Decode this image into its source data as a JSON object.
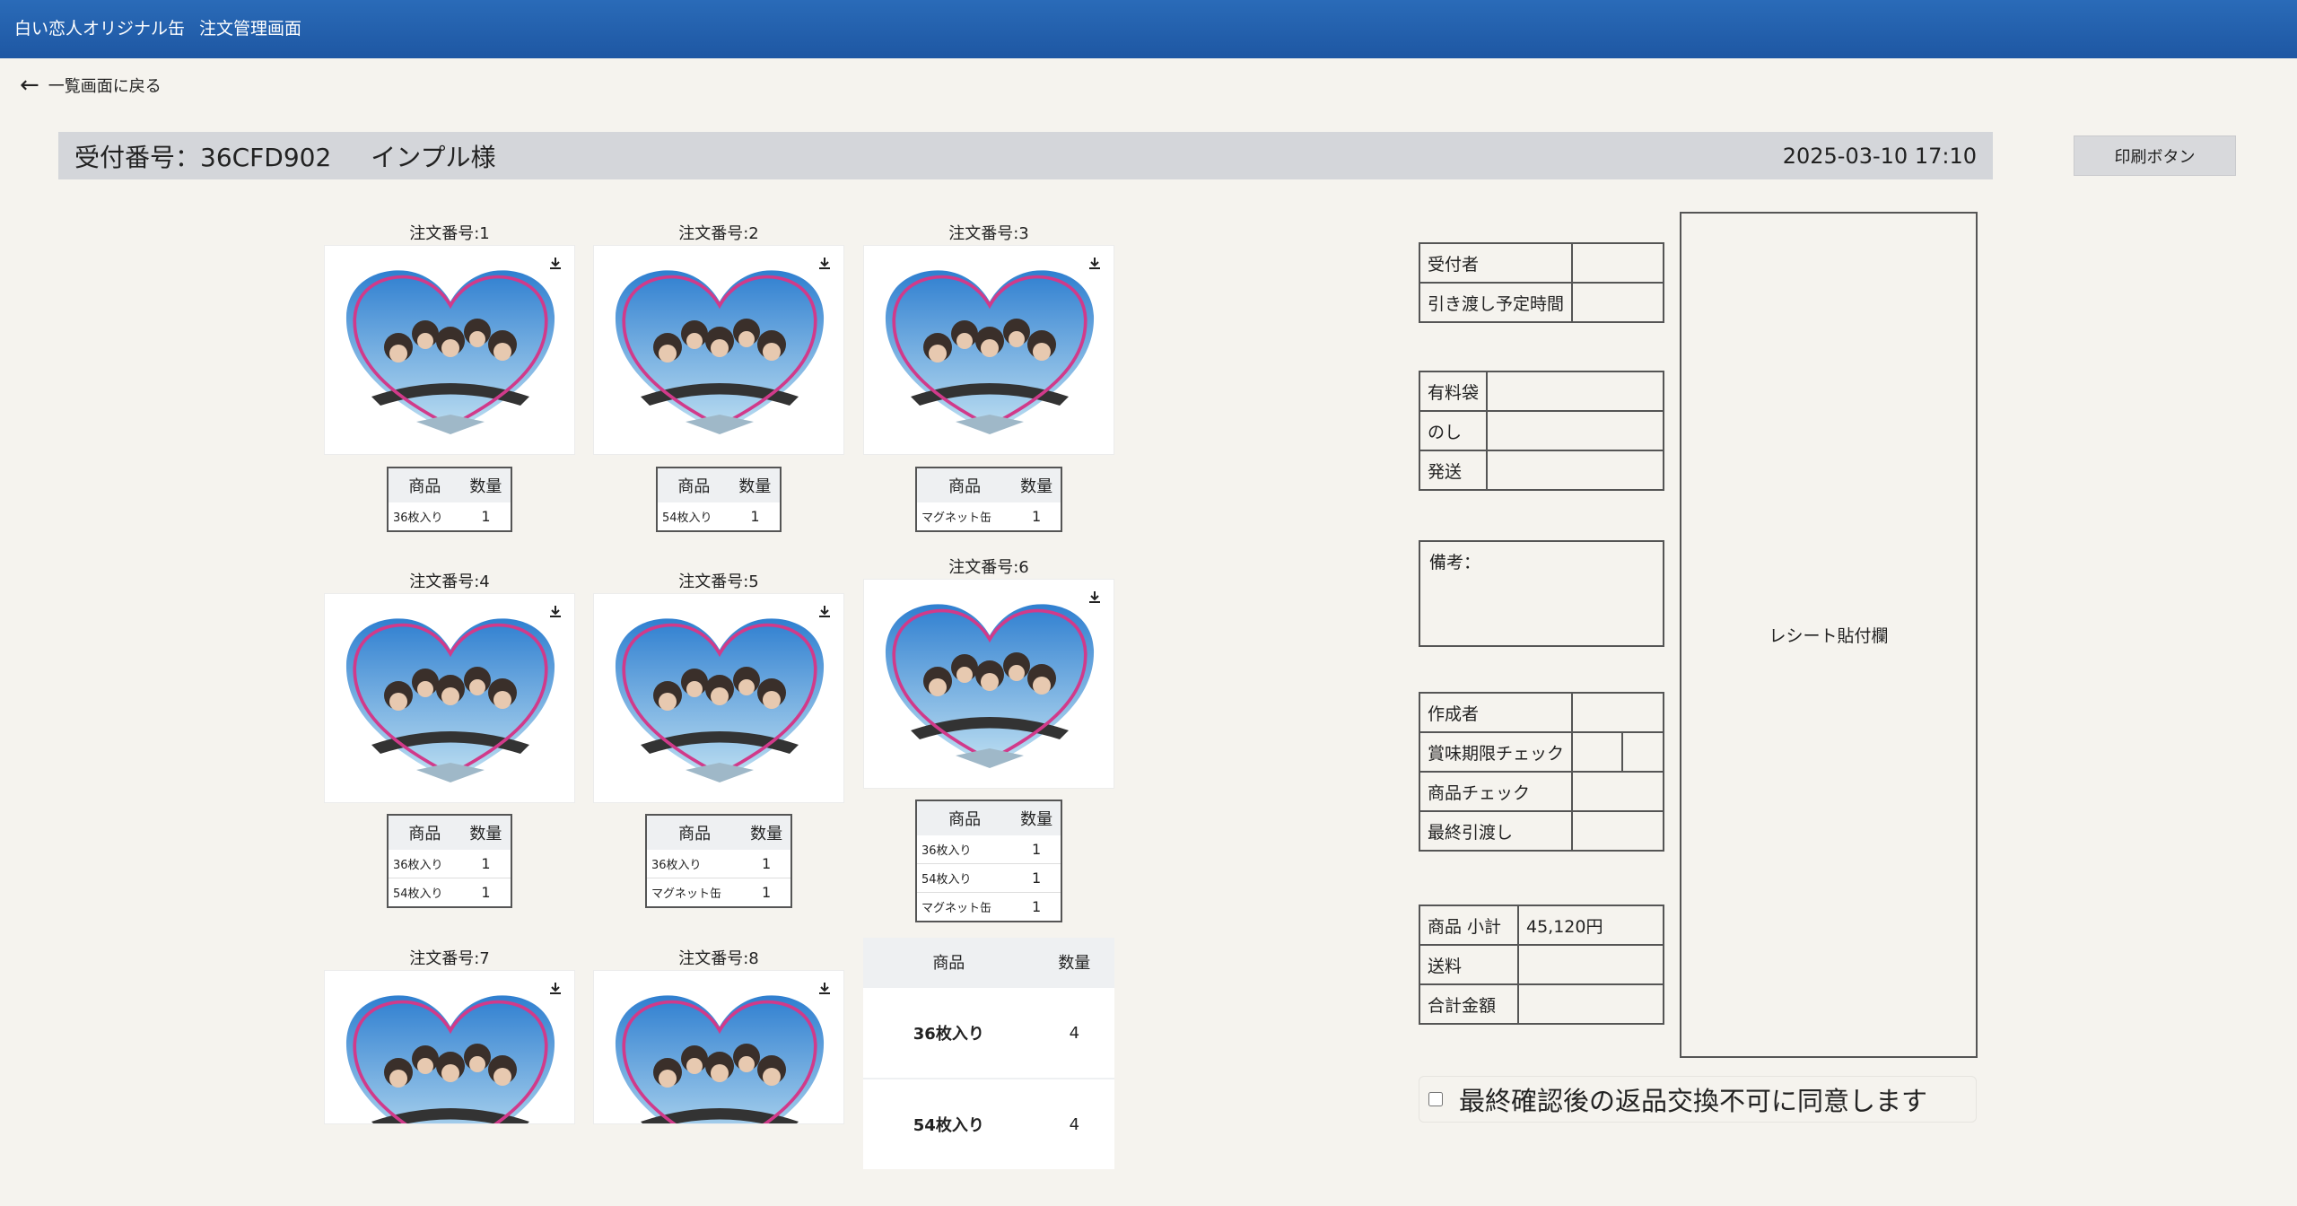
{
  "header": {
    "app_name": "白い恋人オリジナル缶",
    "screen_name": "注文管理画面"
  },
  "back_link": {
    "label": "一覧画面に戻る"
  },
  "receipt_header": {
    "number_label": "受付番号：36CFD902",
    "customer": "インプル様",
    "datetime": "2025-03-10 17:10"
  },
  "print_button": {
    "label": "印刷ボタン"
  },
  "orders": [
    {
      "label": "注文番号:1",
      "items": [
        {
          "name": "36枚入り",
          "qty": "1"
        }
      ]
    },
    {
      "label": "注文番号:2",
      "items": [
        {
          "name": "54枚入り",
          "qty": "1"
        }
      ]
    },
    {
      "label": "注文番号:3",
      "items": [
        {
          "name": "マグネット缶",
          "qty": "1"
        }
      ]
    },
    {
      "label": "注文番号:4",
      "items": [
        {
          "name": "36枚入り",
          "qty": "1"
        },
        {
          "name": "54枚入り",
          "qty": "1"
        }
      ]
    },
    {
      "label": "注文番号:5",
      "items": [
        {
          "name": "36枚入り",
          "qty": "1"
        },
        {
          "name": "マグネット缶",
          "qty": "1"
        }
      ]
    },
    {
      "label": "注文番号:6",
      "items": [
        {
          "name": "36枚入り",
          "qty": "1"
        },
        {
          "name": "54枚入り",
          "qty": "1"
        },
        {
          "name": "マグネット缶",
          "qty": "1"
        }
      ]
    },
    {
      "label": "注文番号:7",
      "items": []
    },
    {
      "label": "注文番号:8",
      "items": []
    }
  ],
  "table_headers": {
    "product": "商品",
    "qty": "数量"
  },
  "summary_table": {
    "rows": [
      {
        "name": "36枚入り",
        "qty": "4"
      },
      {
        "name": "54枚入り",
        "qty": "4"
      }
    ]
  },
  "form": {
    "group1": {
      "receiver": "受付者",
      "handover_time": "引き渡し予定時間"
    },
    "group2": {
      "bag": "有料袋",
      "noshi": "のし",
      "shipping": "発送"
    },
    "remarks_label": "備考：",
    "group3": {
      "creator": "作成者",
      "expiry_check": "賞味期限チェック",
      "product_check": "商品チェック",
      "final_handover": "最終引渡し"
    },
    "group4": {
      "subtotal_label": "商品 小計",
      "subtotal_value": "45,120円",
      "postage": "送料",
      "total": "合計金額"
    }
  },
  "receipt_area": {
    "label": "レシート貼付欄"
  },
  "agreement": {
    "label": "最終確認後の返品交換不可に同意します",
    "checked": false
  },
  "colors": {
    "header_bg": "#1e57a3",
    "page_bg": "#f5f3ee",
    "title_bar_bg": "#d4d6da",
    "heart_outline": "#d13a8a"
  }
}
